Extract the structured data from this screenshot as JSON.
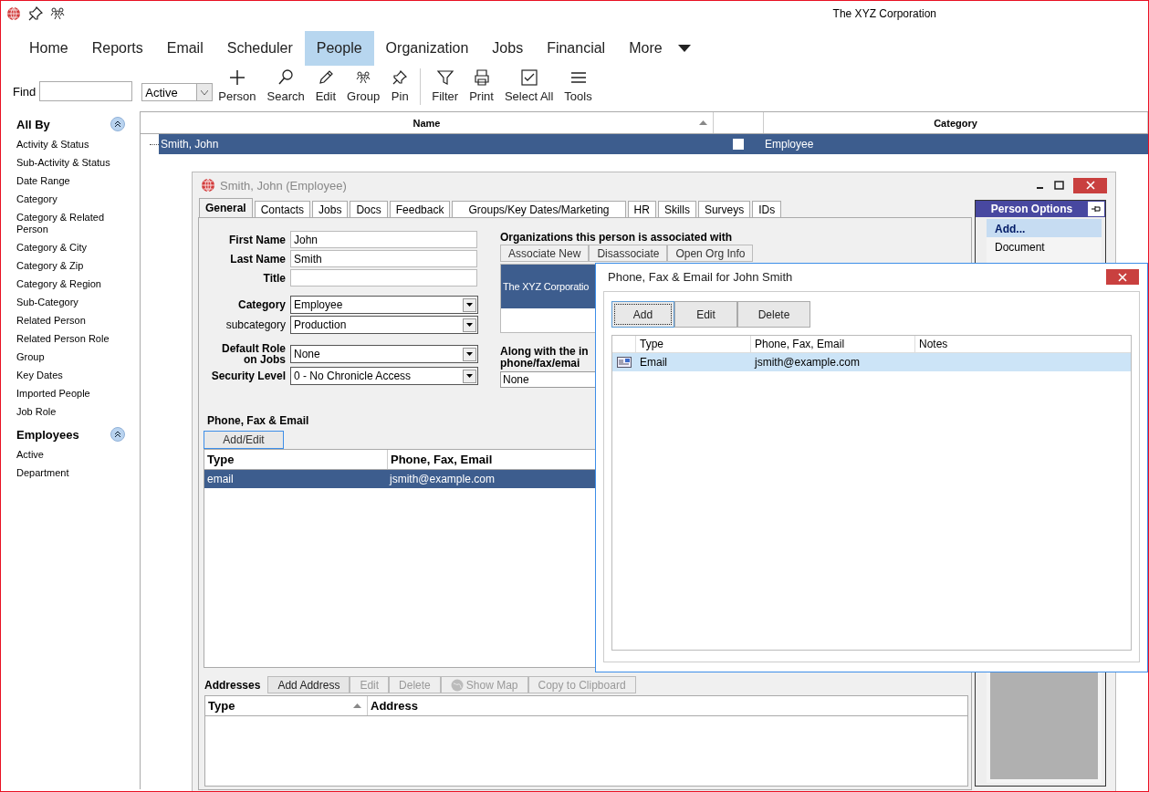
{
  "app": {
    "title": "The XYZ Corporation"
  },
  "menu": [
    {
      "label": "Home",
      "selected": false
    },
    {
      "label": "Reports",
      "selected": false
    },
    {
      "label": "Email",
      "selected": false
    },
    {
      "label": "Scheduler",
      "selected": false
    },
    {
      "label": "People",
      "selected": true
    },
    {
      "label": "Organization",
      "selected": false
    },
    {
      "label": "Jobs",
      "selected": false
    },
    {
      "label": "Financial",
      "selected": false
    },
    {
      "label": "More",
      "selected": false
    }
  ],
  "toolbar": {
    "find_label": "Find",
    "status_select": "Active",
    "buttons": [
      {
        "label": "Person",
        "kind": "add"
      },
      {
        "label": "Search",
        "kind": "search"
      },
      {
        "label": "Edit",
        "kind": "edit"
      },
      {
        "label": "Group",
        "kind": "group"
      },
      {
        "label": "Pin",
        "kind": "pin"
      },
      {
        "label": "Filter",
        "kind": "filter",
        "separator_before": true
      },
      {
        "label": "Print",
        "kind": "print"
      },
      {
        "label": "Select All",
        "kind": "select-all"
      },
      {
        "label": "Tools",
        "kind": "tools"
      }
    ]
  },
  "sidebar": [
    {
      "title": "All By",
      "expanded": true,
      "items": [
        "Activity & Status",
        "Sub-Activity & Status",
        "Date Range",
        "Category",
        "Category & Related Person",
        "Category & City",
        "Category & Zip",
        "Category & Region",
        "Sub-Category",
        "Related Person",
        "Related Person  Role",
        "Group",
        "Key Dates",
        "Imported People",
        "Job Role"
      ]
    },
    {
      "title": "Employees",
      "expanded": true,
      "items": [
        "Active",
        "Department"
      ]
    }
  ],
  "grid": {
    "columns": [
      "Name",
      "Category"
    ],
    "rows": [
      {
        "name": "Smith, John",
        "checked": false,
        "category": "Employee",
        "selected": true
      }
    ]
  },
  "person_window": {
    "title": "Smith, John (Employee)",
    "tabs": [
      {
        "label": "General",
        "selected": true
      },
      {
        "label": "Contacts",
        "selected": false
      },
      {
        "label": "Jobs",
        "selected": false
      },
      {
        "label": "Docs",
        "selected": false
      },
      {
        "label": "Feedback",
        "selected": false
      },
      {
        "label": "Groups/Key Dates/Marketing",
        "selected": false
      },
      {
        "label": "HR",
        "selected": false
      },
      {
        "label": "Skills",
        "selected": false
      },
      {
        "label": "Surveys",
        "selected": false
      },
      {
        "label": "IDs",
        "selected": false
      }
    ],
    "field_groups": [
      [
        {
          "label": "First Name",
          "bold": true,
          "kind": "text",
          "value": "John"
        },
        {
          "label": "Last Name",
          "bold": true,
          "kind": "text",
          "value": "Smith"
        },
        {
          "label": "Title",
          "bold": true,
          "kind": "text"
        }
      ],
      [
        {
          "label": "Category",
          "bold": true,
          "kind": "select",
          "value": "Employee"
        },
        {
          "label": "subcategory",
          "bold": false,
          "kind": "select",
          "value": "Production"
        }
      ],
      [
        {
          "label": "Default Role on Jobs",
          "bold": true,
          "kind": "select",
          "value": "None"
        },
        {
          "label": "Security Level",
          "bold": true,
          "kind": "select",
          "value": "0 - No Chronicle Access"
        }
      ]
    ],
    "organizations": {
      "heading": "Organizations this person is associated with",
      "buttons": [
        "Associate New",
        "Disassociate",
        "Open Org Info"
      ],
      "rows": [
        {
          "name": "The XYZ Corporatio",
          "selected": true
        }
      ]
    },
    "along_with": {
      "lines": [
        "Along with the in",
        "phone/fax/emai"
      ],
      "value": "None"
    },
    "phones": {
      "heading": "Phone, Fax & Email",
      "button": "Add/Edit",
      "columns": [
        "Type",
        "Phone, Fax, Email"
      ],
      "rows": [
        {
          "type": "email",
          "value": "jsmith@example.com",
          "selected": true
        }
      ]
    },
    "addresses": {
      "heading": "Addresses",
      "buttons": [
        {
          "label": "Add Address",
          "disabled": false
        },
        {
          "label": "Edit",
          "disabled": true
        },
        {
          "label": "Delete",
          "disabled": true
        },
        {
          "label": "Show Map",
          "disabled": true,
          "kind": "map"
        },
        {
          "label": "Copy to Clipboard",
          "disabled": true
        }
      ],
      "columns": [
        "Type",
        "Address"
      ]
    },
    "options": {
      "title": "Person Options",
      "items": [
        {
          "label": "Add...",
          "selected": true
        },
        {
          "label": "Document",
          "selected": false
        }
      ]
    }
  },
  "dialog": {
    "title": "Phone, Fax & Email for John Smith",
    "buttons": [
      {
        "label": "Add",
        "selected": true
      },
      {
        "label": "Edit",
        "selected": false
      },
      {
        "label": "Delete",
        "selected": false
      }
    ],
    "columns": [
      "Type",
      "Phone, Fax, Email",
      "Notes"
    ],
    "rows": [
      {
        "type": "Email",
        "value": "jsmith@example.com",
        "selected": true
      }
    ]
  }
}
